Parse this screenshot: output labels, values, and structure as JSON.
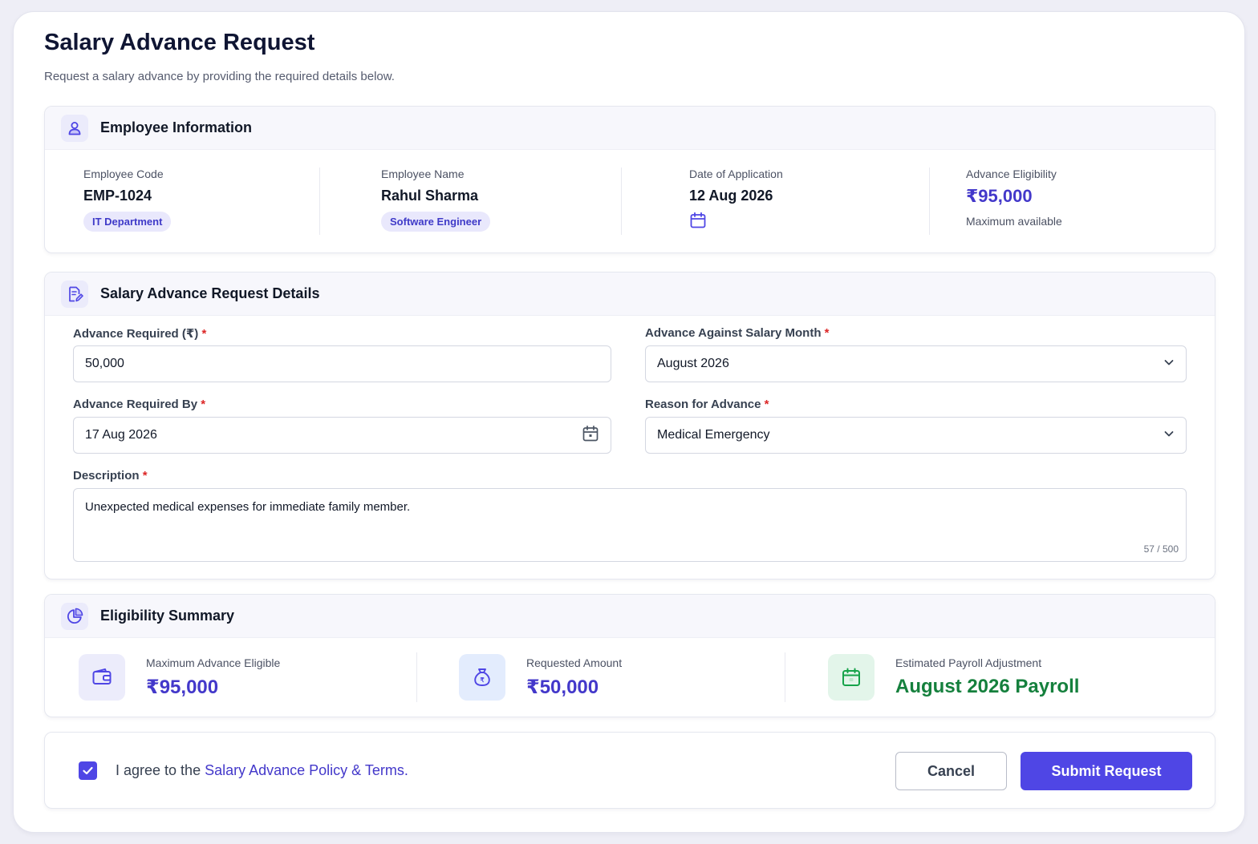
{
  "page": {
    "title": "Salary Advance Request",
    "subtitle": "Request a salary advance by providing the required details below."
  },
  "employee_info": {
    "title": "Employee Information",
    "icon": "user-icon",
    "code_label": "Employee Code",
    "code_value": "EMP-1024",
    "department": "IT Department",
    "name_label": "Employee Name",
    "name_value": "Rahul Sharma",
    "designation": "Software Engineer",
    "date_label": "Date of Application",
    "date_value": "12 Aug 2026",
    "eligibility_label": "Advance Eligibility",
    "eligibility_value": "₹95,000",
    "eligibility_note": "Maximum available"
  },
  "request_details": {
    "title": "Salary Advance Request Details",
    "icon": "edit-document-icon",
    "required_marker": "*",
    "amount_label": "Advance Required (₹)",
    "amount_value": "50,000",
    "month_label": "Advance Against Salary Month",
    "month_value": "August 2026",
    "required_by_label": "Advance Required By",
    "required_by_value": "17 Aug 2026",
    "reason_label": "Reason for Advance",
    "reason_value": "Medical Emergency",
    "description_label": "Description",
    "description_value": "Unexpected medical expenses for immediate family member.",
    "description_counter": "57 / 500"
  },
  "eligibility_summary": {
    "title": "Eligibility Summary",
    "icon": "pie-chart-icon",
    "items": [
      {
        "label": "Maximum Advance Eligible",
        "value": "₹95,000",
        "icon": "wallet-icon",
        "color": "#4338ca"
      },
      {
        "label": "Requested Amount",
        "value": "₹50,000",
        "icon": "money-bag-icon",
        "color": "#4338ca"
      },
      {
        "label": "Estimated Payroll Adjustment",
        "value": "August 2026 Payroll",
        "icon": "calendar-icon",
        "color": "#15803d"
      }
    ]
  },
  "footer": {
    "agree_checked": true,
    "agree_prefix": "I agree to the ",
    "agree_link": "Salary Advance Policy & Terms.",
    "cancel_label": "Cancel",
    "submit_label": "Submit Request"
  },
  "colors": {
    "accent": "#4f46e5",
    "accent_text": "#4338ca",
    "success": "#15803d",
    "required": "#dc2626"
  }
}
